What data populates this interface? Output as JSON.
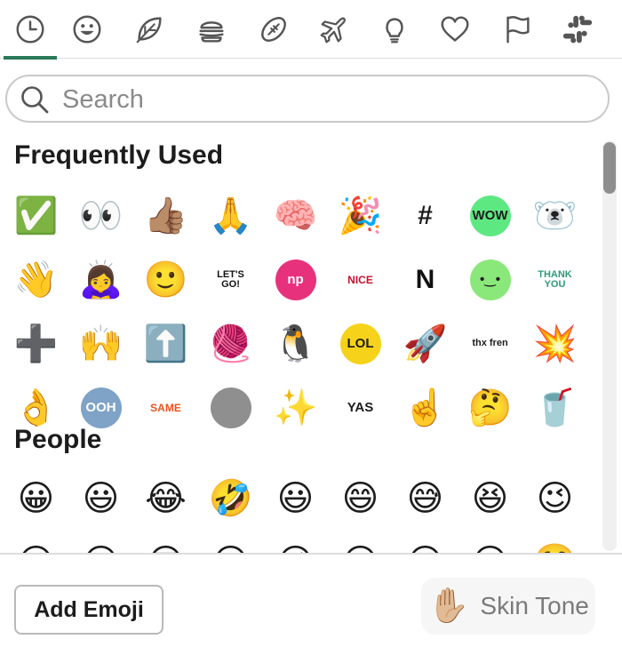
{
  "tabs": [
    {
      "name": "recent",
      "icon": "clock-icon"
    },
    {
      "name": "smileys",
      "icon": "smiley-icon"
    },
    {
      "name": "nature",
      "icon": "leaf-icon"
    },
    {
      "name": "food",
      "icon": "burger-icon"
    },
    {
      "name": "activity",
      "icon": "football-icon"
    },
    {
      "name": "travel",
      "icon": "airplane-icon"
    },
    {
      "name": "objects",
      "icon": "lightbulb-icon"
    },
    {
      "name": "symbols",
      "icon": "heart-icon"
    },
    {
      "name": "flags",
      "icon": "flag-icon"
    },
    {
      "name": "custom",
      "icon": "slack-icon"
    }
  ],
  "active_tab": "recent",
  "search": {
    "placeholder": "Search",
    "value": ""
  },
  "sections": {
    "frequently_used": {
      "title": "Frequently Used",
      "emojis": [
        {
          "name": "white-check-mark",
          "glyph": "✅"
        },
        {
          "name": "eyes",
          "glyph": "👀"
        },
        {
          "name": "thumbsup-medium-dark",
          "glyph": "👍🏽"
        },
        {
          "name": "pray",
          "glyph": "🙏"
        },
        {
          "name": "brain",
          "glyph": "🧠"
        },
        {
          "name": "tada",
          "glyph": "🎉"
        },
        {
          "name": "hashtag-custom",
          "text": "#",
          "fg": "#1d1c1d",
          "bg": "#ffffff"
        },
        {
          "name": "wow-custom",
          "text": "WOW",
          "fg": "#1d1c1d",
          "bg": "#5ee882"
        },
        {
          "name": "polar-bear-custom",
          "glyph": "🐻‍❄️"
        },
        {
          "name": "wave",
          "glyph": "👋"
        },
        {
          "name": "woman-bowing",
          "glyph": "🙇‍♀️"
        },
        {
          "name": "smile-pixel-custom",
          "glyph": "🙂"
        },
        {
          "name": "lets-go-custom",
          "text": "LET'S GO!",
          "fg": "#111111",
          "bg": "#ffffff"
        },
        {
          "name": "np-custom",
          "text": "np",
          "fg": "#ffffff",
          "bg": "#e8317c"
        },
        {
          "name": "nice-custom",
          "text": "NICE",
          "fg": "#c8102e",
          "bg": "#ffffff"
        },
        {
          "name": "notion-custom",
          "text": "N",
          "fg": "#111111",
          "bg": "#ffffff"
        },
        {
          "name": "blob-smile-custom",
          "text": "•‿•",
          "fg": "#1d1c1d",
          "bg": "#8ae87a"
        },
        {
          "name": "thank-you-custom",
          "text": "THANK YOU",
          "fg": "#2f9a7a",
          "bg": "#ffffff"
        },
        {
          "name": "heavy-plus-sign",
          "glyph": "➕"
        },
        {
          "name": "raised-hands",
          "glyph": "🙌"
        },
        {
          "name": "arrow-up",
          "glyph": "⬆️"
        },
        {
          "name": "yarn",
          "glyph": "🧶"
        },
        {
          "name": "penguin",
          "glyph": "🐧"
        },
        {
          "name": "lol-custom",
          "text": "LOL",
          "fg": "#1d1c1d",
          "bg": "#f6d21a"
        },
        {
          "name": "rocket",
          "glyph": "🚀"
        },
        {
          "name": "thx-fren-custom",
          "text": "thx fren",
          "fg": "#1d1c1d",
          "bg": "#ffffff"
        },
        {
          "name": "boom",
          "glyph": "💥"
        },
        {
          "name": "ok-hand",
          "glyph": "👌"
        },
        {
          "name": "ooh-custom",
          "text": "OOH",
          "fg": "#ffffff",
          "bg": "#7fa3c7"
        },
        {
          "name": "same-custom",
          "text": "SAME",
          "fg": "#e8541c",
          "bg": "#ffffff"
        },
        {
          "name": "photo-custom",
          "text": "",
          "fg": "#ffffff",
          "bg": "#8f8f8f"
        },
        {
          "name": "sparkles",
          "glyph": "✨"
        },
        {
          "name": "yas-custom",
          "text": "YAS",
          "fg": "#1d1c1d",
          "bg": "#ffffff"
        },
        {
          "name": "point-up",
          "glyph": "☝️"
        },
        {
          "name": "thinking-face",
          "glyph": "🤔"
        },
        {
          "name": "coke-custom",
          "glyph": "🥤"
        }
      ]
    },
    "people": {
      "title": "People",
      "emojis": [
        {
          "name": "grinning",
          "glyph": "😀"
        },
        {
          "name": "smiley",
          "glyph": "😃"
        },
        {
          "name": "joy",
          "glyph": "😂"
        },
        {
          "name": "rolling-on-the-floor-laughing",
          "glyph": "🤣"
        },
        {
          "name": "smile-open",
          "glyph": "😃"
        },
        {
          "name": "smile",
          "glyph": "😄"
        },
        {
          "name": "sweat-smile",
          "glyph": "😅"
        },
        {
          "name": "laughing",
          "glyph": "😆"
        },
        {
          "name": "wink",
          "glyph": "😉"
        },
        {
          "name": "blush",
          "glyph": "😊"
        },
        {
          "name": "yum",
          "glyph": "😋"
        },
        {
          "name": "sunglasses",
          "glyph": "😎"
        },
        {
          "name": "heart-eyes",
          "glyph": "😍"
        },
        {
          "name": "kissing-heart",
          "glyph": "😘"
        },
        {
          "name": "kissing",
          "glyph": "😗"
        },
        {
          "name": "kissing-smiling-eyes",
          "glyph": "😙"
        },
        {
          "name": "kissing-closed-eyes",
          "glyph": "😚"
        },
        {
          "name": "relaxed",
          "glyph": "☺️"
        }
      ]
    }
  },
  "footer": {
    "add_emoji_label": "Add Emoji",
    "skin_tone_label": "Skin Tone",
    "skin_tone_icon": "✋🏼"
  },
  "colors": {
    "accent": "#2a7a5a",
    "border": "#dddddd"
  }
}
